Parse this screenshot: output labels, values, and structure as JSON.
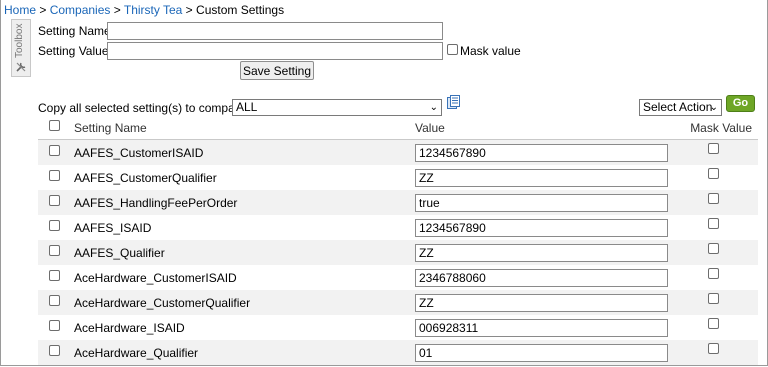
{
  "breadcrumb": {
    "home": "Home",
    "sep1": " > ",
    "companies": "Companies",
    "sep2": " > ",
    "company": "Thirsty Tea",
    "sep3": " > ",
    "current": "Custom Settings"
  },
  "toolbox": {
    "label": "Toolbox",
    "icon": "tools-icon"
  },
  "form": {
    "setting_name_label": "Setting Name:",
    "setting_name_value": "",
    "setting_value_label": "Setting Value",
    "setting_value_value": "",
    "mask_label": "Mask value",
    "save_button": "Save Setting"
  },
  "copy_bar": {
    "label": "Copy all selected setting(s) to company",
    "company_select": "ALL",
    "copy_icon": "copy-document-icon",
    "action_select": "Select Action",
    "go_button": "Go"
  },
  "table": {
    "headers": {
      "name": "Setting Name",
      "value": "Value",
      "mask": "Mask Value"
    },
    "rows": [
      {
        "name": "AAFES_CustomerISAID",
        "value": "1234567890"
      },
      {
        "name": "AAFES_CustomerQualifier",
        "value": "ZZ"
      },
      {
        "name": "AAFES_HandlingFeePerOrder",
        "value": "true"
      },
      {
        "name": "AAFES_ISAID",
        "value": "1234567890"
      },
      {
        "name": "AAFES_Qualifier",
        "value": "ZZ"
      },
      {
        "name": "AceHardware_CustomerISAID",
        "value": "2346788060"
      },
      {
        "name": "AceHardware_CustomerQualifier",
        "value": "ZZ"
      },
      {
        "name": "AceHardware_ISAID",
        "value": "006928311"
      },
      {
        "name": "AceHardware_Qualifier",
        "value": "01"
      }
    ]
  },
  "colors": {
    "link": "#1a66b8",
    "go": "#6ea626",
    "row_alt": "#f2f2f2"
  }
}
